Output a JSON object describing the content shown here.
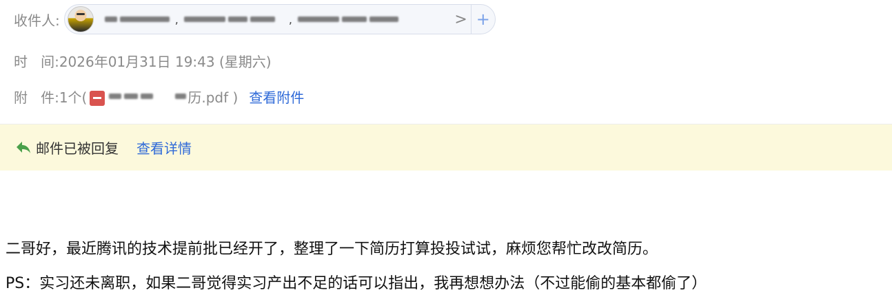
{
  "header": {
    "recipient_label": "收件人:",
    "recipient_more": ">",
    "recipient_add": "+",
    "time_label": "时   间:",
    "time_value": "2026年01月31日 19:43 (星期六)",
    "attachment_label": "附   件:",
    "attachment_count": "1个(",
    "attachment_filename_visible": "历.pdf )",
    "attachment_link": "查看附件"
  },
  "notice": {
    "icon": "reply-arrow-icon",
    "text": "邮件已被回复",
    "link": "查看详情",
    "accent_color": "#fcf9dc"
  },
  "message": {
    "line1": "二哥好，最近腾讯的技术提前批已经开了，整理了一下简历打算投投试试，麻烦您帮忙改改简历。",
    "line2": "PS：实习还未离职，如果二哥觉得实习产出不足的话可以指出，我再想想办法（不过能偷的基本都偷了）"
  },
  "colors": {
    "link": "#2f6ad8",
    "label": "#8a8a8a",
    "pill_border": "#d7ddea",
    "pill_bg": "#f5f7fb",
    "pdf_red": "#d9534f"
  }
}
